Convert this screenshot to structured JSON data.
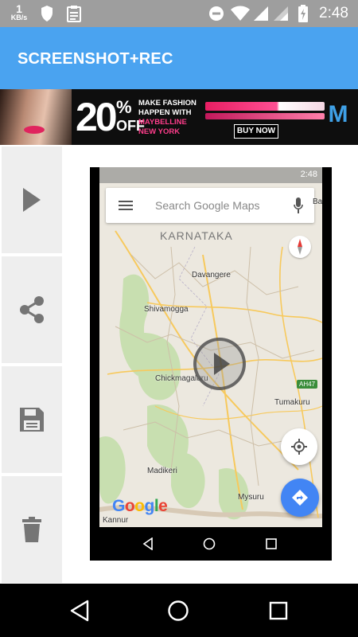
{
  "status_bar": {
    "speed_value": "1",
    "speed_unit": "KB/s",
    "time": "2:48",
    "icons": [
      "shield-icon",
      "clipboard-icon",
      "do-not-disturb-icon",
      "wifi-icon",
      "signal-icon",
      "signal-icon",
      "battery-charging-icon"
    ]
  },
  "app_bar": {
    "title": "SCREENSHOT+REC"
  },
  "ad": {
    "percent": "20",
    "percent_sign": "%",
    "off": "OFF",
    "line1": "MAKE FASHION",
    "line2": "HAPPEN WITH",
    "line3": "MAYBELLINE",
    "line4": "NEW YORK",
    "buy": "BUY NOW",
    "logo": "M"
  },
  "sidebar": {
    "buttons": [
      {
        "name": "play-button",
        "icon": "play-icon"
      },
      {
        "name": "share-button",
        "icon": "share-icon"
      },
      {
        "name": "save-button",
        "icon": "save-icon"
      },
      {
        "name": "delete-button",
        "icon": "trash-icon"
      }
    ]
  },
  "preview": {
    "mini_time": "2:48",
    "search_placeholder": "Search Google Maps",
    "state": "KARNATAKA",
    "cities": {
      "davangere": "Davangere",
      "shivamogga": "Shivamogga",
      "chickmagaluru": "Chickmagaluru",
      "tumakuru": "Tumakuru",
      "madikeri": "Madikeri",
      "mysuru": "Mysuru",
      "kannur": "Kannur",
      "edge": "Ba"
    },
    "highway": "AH47",
    "google_letters": [
      "G",
      "o",
      "o",
      "g",
      "l",
      "e"
    ]
  },
  "colors": {
    "app_bar": "#4aa3f0",
    "status_bar": "#9e9e9e",
    "side_button_bg": "#eeeeee",
    "icon_gray": "#757575",
    "maps_blue": "#4285f4"
  }
}
